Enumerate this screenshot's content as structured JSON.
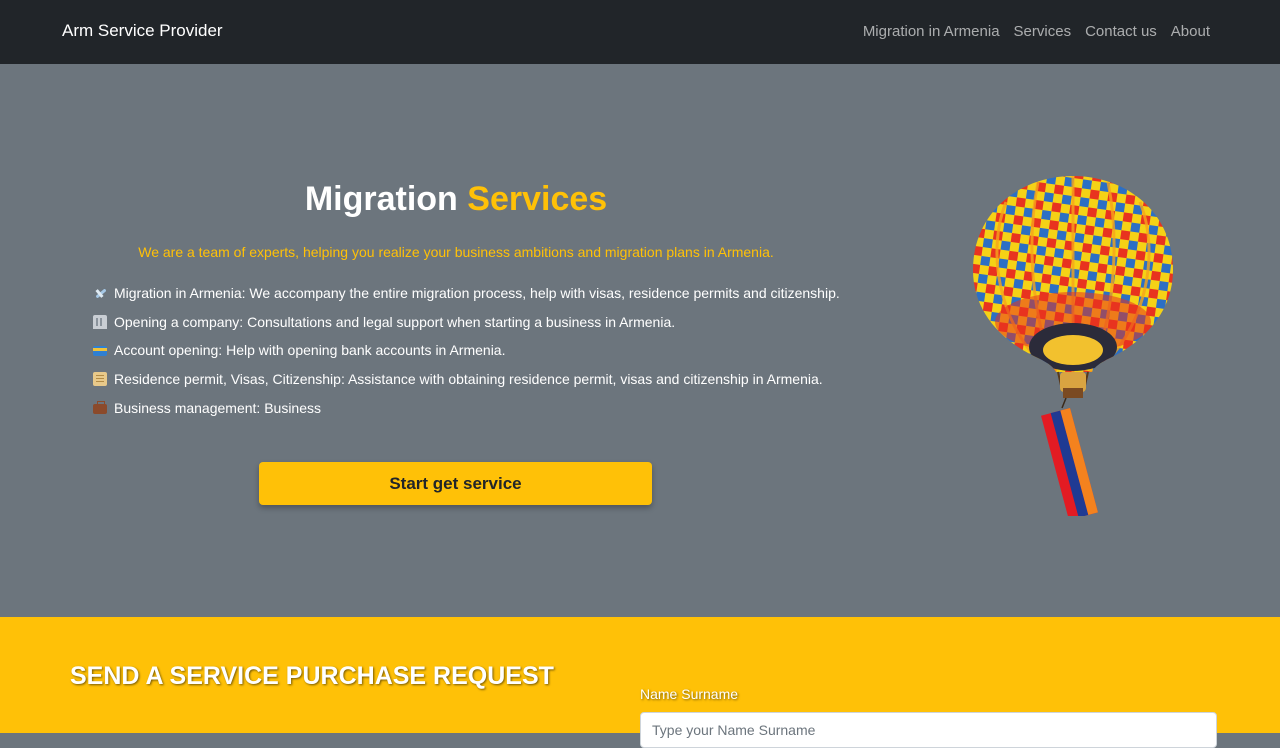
{
  "navbar": {
    "brand": "Arm Service Provider",
    "links": [
      "Migration in Armenia",
      "Services",
      "Contact us",
      "About"
    ]
  },
  "hero": {
    "title_main": "Migration",
    "title_accent": "Services",
    "tagline": "We are a team of experts, helping you realize your business ambitions and migration plans in Armenia.",
    "services": [
      {
        "icon": "airplane-icon",
        "text": "Migration in Armenia: We accompany the entire migration process, help with visas, residence permits and citizenship."
      },
      {
        "icon": "office-building-icon",
        "text": "Opening a company: Consultations and legal support when starting a business in Armenia."
      },
      {
        "icon": "credit-card-icon",
        "text": "Account opening: Help with opening bank accounts in Armenia."
      },
      {
        "icon": "scroll-icon",
        "text": "Residence permit, Visas, Citizenship: Assistance with obtaining residence permit, visas and citizenship in Armenia."
      },
      {
        "icon": "briefcase-icon",
        "text": "Business management: Business"
      }
    ],
    "cta_label": "Start get service"
  },
  "request": {
    "title": "SEND A SERVICE PURCHASE REQUEST",
    "name_label": "Name Surname",
    "name_placeholder": "Type your Name Surname",
    "name_value": ""
  },
  "colors": {
    "navbar": "#212529",
    "hero_bg": "#6c757d",
    "accent": "#ffc107",
    "text_light": "#ffffff"
  }
}
